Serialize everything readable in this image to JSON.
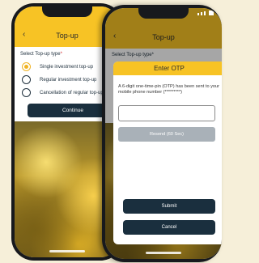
{
  "left_screen": {
    "header": {
      "back_icon": "chevron-left-icon",
      "back_glyph": "‹",
      "title": "Top-up"
    },
    "form": {
      "label": "Select Top-up type",
      "required_mark": "*",
      "options": [
        {
          "label": "Single investment top-up",
          "selected": true
        },
        {
          "label": "Regular investment top-up",
          "selected": false
        },
        {
          "label": "Cancellation of regular top-up",
          "selected": false
        }
      ],
      "continue_label": "Continue"
    }
  },
  "right_screen": {
    "header": {
      "back_glyph": "‹",
      "title": "Top-up"
    },
    "ghost_label": "Select Top-up type*",
    "otp_modal": {
      "title": "Enter OTP",
      "message": "A 6-digit one-time-pin (OTP) has been sent to your mobile phone number (*********)",
      "input_value": "",
      "resend_label": "Resend (60 Sec)",
      "submit_label": "Submit",
      "cancel_label": "Cancel"
    }
  },
  "colors": {
    "header_yellow": "#f7c325",
    "navy_button": "#1a2f3e",
    "disabled_grey": "#a9b1b8",
    "radio_selected": "#f0b323"
  }
}
